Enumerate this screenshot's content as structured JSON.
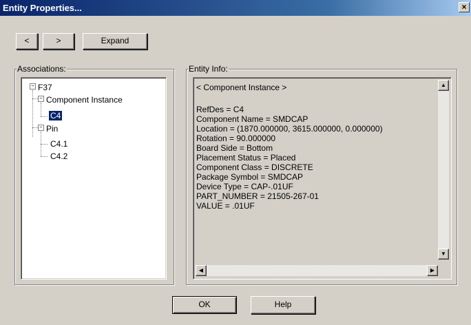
{
  "window": {
    "title": "Entity Properties...",
    "close_glyph": "×"
  },
  "toolbar": {
    "back_label": "<",
    "forward_label": ">",
    "expand_label": "Expand"
  },
  "associations": {
    "group_label": "Associations:",
    "tree": {
      "root": "F37",
      "component_instance": "Component Instance",
      "c4": "C4",
      "pin": "Pin",
      "c4_1": "C4.1",
      "c4_2": "C4.2",
      "expanded_glyph": "−"
    }
  },
  "entity_info": {
    "group_label": "Entity Info:",
    "lines": [
      "< Component Instance >",
      "",
      "RefDes = C4",
      "Component Name = SMDCAP",
      "Location = (1870.000000, 3615.000000, 0.000000)",
      "Rotation = 90.000000",
      "Board Side = Bottom",
      "Placement Status = Placed",
      "Component Class = DISCRETE",
      "Package Symbol = SMDCAP",
      "Device Type = CAP-.01UF",
      "PART_NUMBER = 21505-267-01",
      "VALUE = .01UF"
    ]
  },
  "footer": {
    "ok_label": "OK",
    "help_label": "Help"
  },
  "icons": {
    "scroll_up": "▲",
    "scroll_down": "▼",
    "scroll_left": "◀",
    "scroll_right": "▶"
  }
}
